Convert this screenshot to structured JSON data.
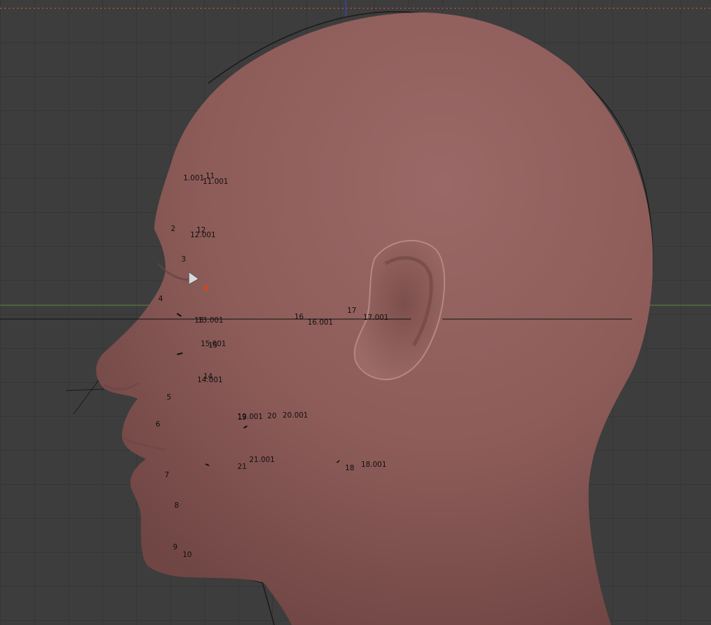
{
  "app": "3D viewport",
  "colors": {
    "background": "#3d3d3d",
    "grid": "#363636",
    "skin": "#93625f",
    "x_axis": "#5a8c3e",
    "z_axis": "#3b45a8",
    "horizon_line": "#111111",
    "selected_vertex": "#e2420c",
    "render_border": "#c06050"
  },
  "landmarks": [
    {
      "id": "l-1001",
      "text": "1.001"
    },
    {
      "id": "l-11",
      "text": "11"
    },
    {
      "id": "l-11001",
      "text": "11.001"
    },
    {
      "id": "l-2",
      "text": "2"
    },
    {
      "id": "l-12",
      "text": "12"
    },
    {
      "id": "l-12001",
      "text": "12.001"
    },
    {
      "id": "l-3",
      "text": "3"
    },
    {
      "id": "l-4",
      "text": "4"
    },
    {
      "id": "l-13a",
      "text": "13"
    },
    {
      "id": "l-13001",
      "text": "13.001"
    },
    {
      "id": "l-16",
      "text": "16"
    },
    {
      "id": "l-16001",
      "text": "16.001"
    },
    {
      "id": "l-17",
      "text": "17"
    },
    {
      "id": "l-17001",
      "text": "17.001"
    },
    {
      "id": "l-15001",
      "text": "15.001"
    },
    {
      "id": "l-15",
      "text": "15"
    },
    {
      "id": "l-14",
      "text": "14"
    },
    {
      "id": "l-14001",
      "text": "14.001"
    },
    {
      "id": "l-5",
      "text": "5"
    },
    {
      "id": "l-19",
      "text": "19"
    },
    {
      "id": "l-19001",
      "text": "19.001"
    },
    {
      "id": "l-20",
      "text": "20"
    },
    {
      "id": "l-20001",
      "text": "20.001"
    },
    {
      "id": "l-6",
      "text": "6"
    },
    {
      "id": "l-21",
      "text": "21"
    },
    {
      "id": "l-21001",
      "text": "21.001"
    },
    {
      "id": "l-18",
      "text": "18"
    },
    {
      "id": "l-18001",
      "text": "18.001"
    },
    {
      "id": "l-7",
      "text": "7"
    },
    {
      "id": "l-8",
      "text": "8"
    },
    {
      "id": "l-9",
      "text": "9"
    },
    {
      "id": "l-10",
      "text": "10"
    }
  ]
}
